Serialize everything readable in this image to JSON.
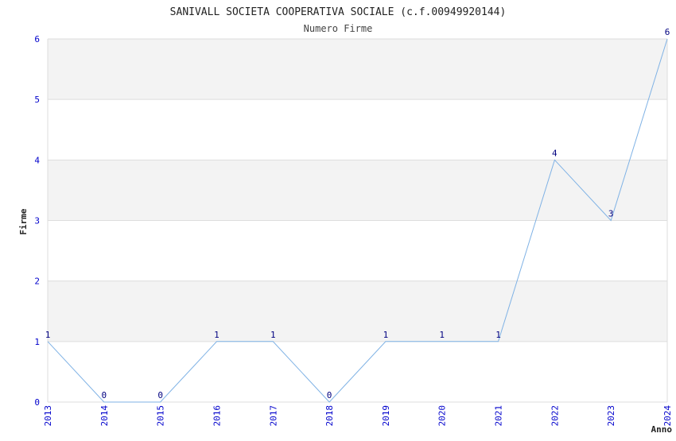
{
  "chart_data": {
    "type": "line",
    "title": "SANIVALL SOCIETA COOPERATIVA SOCIALE (c.f.00949920144)",
    "subtitle": "Numero Firme",
    "xlabel": "Anno",
    "ylabel": "Firme",
    "categories": [
      "2013",
      "2014",
      "2015",
      "2016",
      "2017",
      "2018",
      "2019",
      "2020",
      "2021",
      "2022",
      "2023",
      "2024"
    ],
    "series": [
      {
        "values": [
          1,
          0,
          0,
          1,
          1,
          0,
          1,
          1,
          1,
          4,
          3,
          6
        ]
      }
    ],
    "data_labels": [
      "1",
      "0",
      "0",
      "1",
      "1",
      "0",
      "1",
      "1",
      "1",
      "4",
      "3",
      "6"
    ],
    "y_ticks": [
      "0",
      "1",
      "2",
      "3",
      "4",
      "5",
      "6"
    ],
    "ylim": [
      0,
      6
    ],
    "grid": true,
    "colors": {
      "line": "#7fb2e5",
      "tick_text": "#0000cc",
      "data_label": "#000080",
      "band": "#f3f3f3",
      "grid": "#dddddd"
    }
  }
}
